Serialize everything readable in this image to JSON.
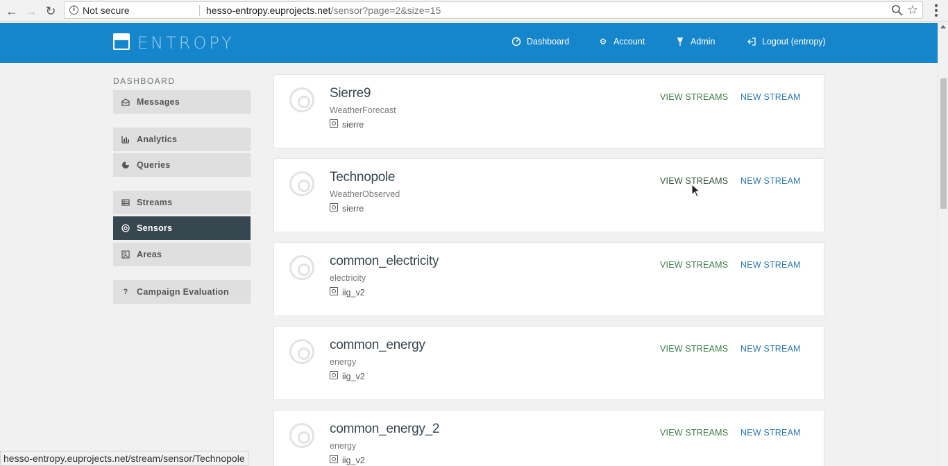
{
  "browser": {
    "security_label": "Not secure",
    "url_host": "hesso-entropy.euprojects.net",
    "url_path": "/sensor?page=2&size=15",
    "status_url": "hesso-entropy.euprojects.net/stream/sensor/Technopole"
  },
  "header": {
    "logo_text": "ENTROPY",
    "links": [
      {
        "label": "Dashboard",
        "icon": "dashboard-icon"
      },
      {
        "label": "Account",
        "icon": "gear-icon"
      },
      {
        "label": "Admin",
        "icon": "pin-icon"
      },
      {
        "label": "Logout (entropy)",
        "icon": "logout-icon"
      }
    ]
  },
  "sidebar": {
    "title": "DASHBOARD",
    "items": [
      {
        "label": "Messages",
        "icon": "envelope-icon"
      },
      {
        "label": "Analytics",
        "icon": "bar-chart-icon"
      },
      {
        "label": "Queries",
        "icon": "pie-chart-icon"
      },
      {
        "label": "Streams",
        "icon": "table-icon"
      },
      {
        "label": "Sensors",
        "icon": "target-icon",
        "active": true
      },
      {
        "label": "Areas",
        "icon": "map-icon"
      },
      {
        "label": "Campaign Evaluation",
        "icon": "question-icon"
      }
    ]
  },
  "sensors": [
    {
      "name": "Sierre9",
      "type": "WeatherForecast",
      "area": "sierre",
      "view_label": "VIEW STREAMS",
      "new_label": "NEW STREAM"
    },
    {
      "name": "Technopole",
      "type": "WeatherObserved",
      "area": "sierre",
      "view_label": "VIEW STREAMS",
      "new_label": "NEW STREAM"
    },
    {
      "name": "common_electricity",
      "type": "electricity",
      "area": "iig_v2",
      "view_label": "VIEW STREAMS",
      "new_label": "NEW STREAM"
    },
    {
      "name": "common_energy",
      "type": "energy",
      "area": "iig_v2",
      "view_label": "VIEW STREAMS",
      "new_label": "NEW STREAM"
    },
    {
      "name": "common_energy_2",
      "type": "energy",
      "area": "iig_v2",
      "view_label": "VIEW STREAMS",
      "new_label": "NEW STREAM"
    }
  ],
  "colors": {
    "header_blue": "#1686cc",
    "sidebar_active": "#37474f",
    "view_green": "#3a7d44",
    "new_blue": "#2a7ab9"
  }
}
